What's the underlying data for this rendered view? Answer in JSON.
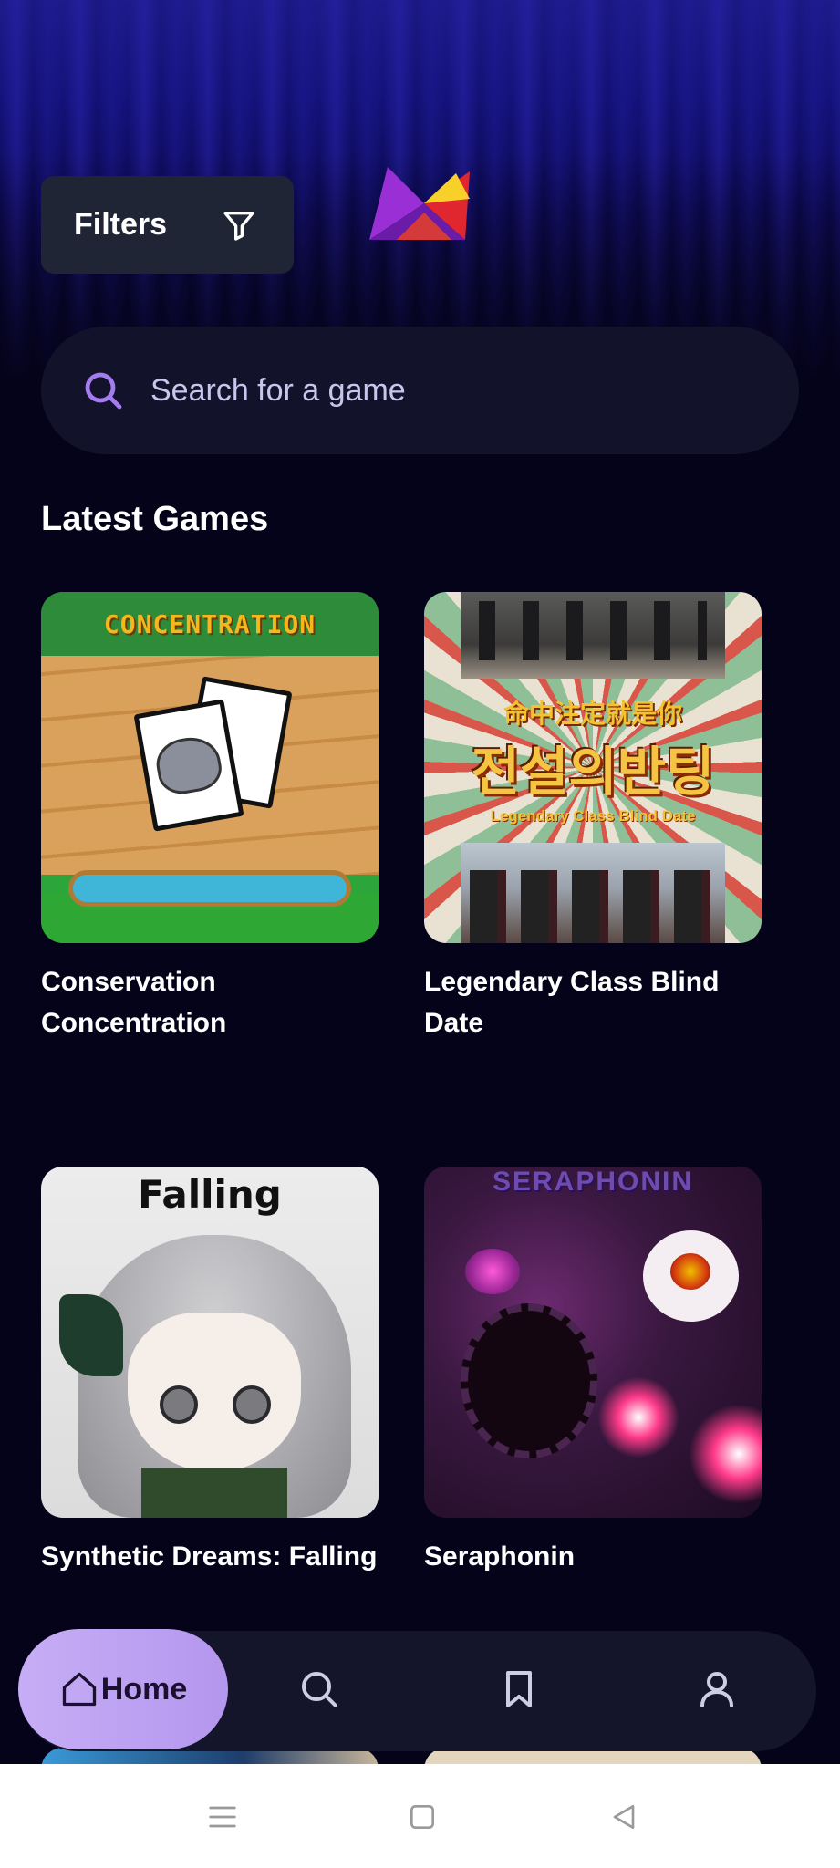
{
  "header": {
    "filters_label": "Filters",
    "logo_icon": "app-logo"
  },
  "search": {
    "placeholder": "Search for a game",
    "icon": "search-icon"
  },
  "section": {
    "title": "Latest Games"
  },
  "games": [
    {
      "title": "Conservation Concentration",
      "art_text": "CONCENTRATION"
    },
    {
      "title": "Legendary Class Blind Date",
      "art_text_cn": "命中注定就是你",
      "art_text_kr": "전설의반팅",
      "art_text_en": "Legendary Class Blind Date"
    },
    {
      "title": "Synthetic Dreams: Falling",
      "art_text": "Falling"
    },
    {
      "title": "Seraphonin",
      "art_text": "SERAPHONIN"
    }
  ],
  "nav": {
    "home_label": "Home",
    "items": [
      "home-icon",
      "search-icon",
      "bookmark-icon",
      "profile-icon"
    ]
  },
  "system_nav": [
    "menu-icon",
    "home-square-icon",
    "back-icon"
  ],
  "colors": {
    "background": "#05031a",
    "accent": "#b497ee",
    "search_icon": "#a57cf0"
  }
}
